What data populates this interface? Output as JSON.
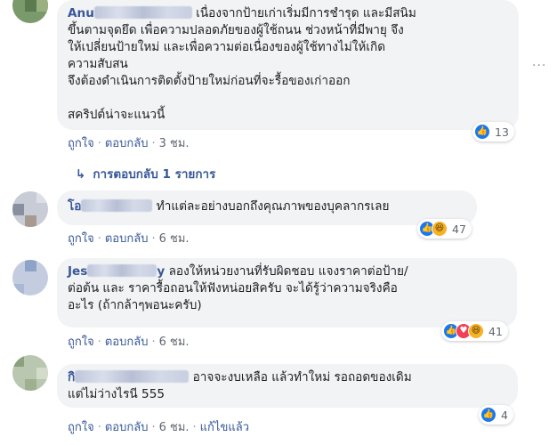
{
  "comments": [
    {
      "name": "Anu",
      "text_lines": [
        "เนื่องจากป้ายเก่าเริ่มมีการชำรุด และมีสนิม",
        "ขึ้นตามจุดยึด เพื่อความปลอดภัยของผู้ใช้ถนน ช่วงหน้าที่มีพายุ จึง",
        "ให้เปลี่ยนป้ายใหม่ และเพื่อความต่อเนื่องของผู้ใช้ทางไม่ให้เกิด",
        "ความสับสน",
        "จึงต้องดำเนินการติดตั้งป้ายใหม่ก่อนที่จะรื้อของเก่าออก",
        "",
        "สคริปต์น่าจะแนวนี้"
      ],
      "like": "ถูกใจ",
      "reply": "ตอบกลับ",
      "time": "3 ชม.",
      "reaction_count": "13",
      "reactions": [
        "like"
      ]
    },
    {
      "name": "โอ",
      "text_lines": [
        "ทำแต่ละอย่างบอกถึงคุณภาพของบุคลากรเลย"
      ],
      "like": "ถูกใจ",
      "reply": "ตอบกลับ",
      "time": "6 ชม.",
      "reaction_count": "47",
      "reactions": [
        "like",
        "haha"
      ]
    },
    {
      "name": "Jes",
      "name_tail": "y",
      "text_lines": [
        "ลองให้หน่วยงานที่รับผิดชอบ แจงราคาต่อป้าย/",
        "ต่อต้น และ ราคารื้อถอนให้ฟังหน่อยสิครับ จะได้รู้ว่าความจริงคือ",
        "อะไร (ถ้ากล้าๆพอนะครับ)"
      ],
      "like": "ถูกใจ",
      "reply": "ตอบกลับ",
      "time": "6 ชม.",
      "reaction_count": "41",
      "reactions": [
        "like",
        "love",
        "haha"
      ]
    },
    {
      "name": "กิ",
      "text_lines": [
        "อาจจะงบเหลือ แล้วทำใหม่ รอถอดของเดิม",
        "แต่ไม่ว่างไรนี 555"
      ],
      "like": "ถูกใจ",
      "reply": "ตอบกลับ",
      "time": "6 ชม.",
      "edited": "แก้ไขแล้ว",
      "reaction_count": "4",
      "reactions": [
        "like"
      ]
    }
  ],
  "replies_link": "การตอบกลับ 1 รายการ",
  "icons": {
    "reply_arrow": "reply-arrow-icon",
    "more": "more-options-icon"
  },
  "colors": {
    "link": "#385898",
    "bubble": "#f2f3f5",
    "like": "#1877f2",
    "love": "#f33e58",
    "haha": "#f7b125"
  }
}
